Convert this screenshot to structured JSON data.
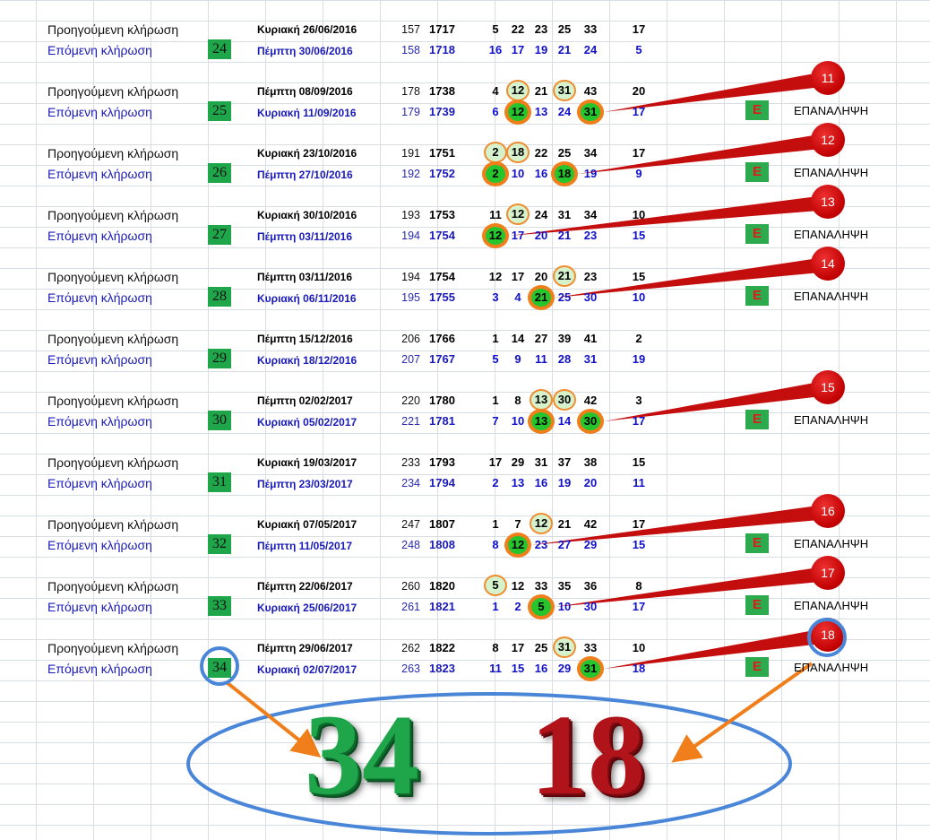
{
  "labels": {
    "prev": "Προηγούμενη κλήρωση",
    "next": "Επόμενη κλήρωση",
    "e_badge": "E",
    "repeat": "ΕΠΑΝΑΛΗΨΗ"
  },
  "blocks": [
    {
      "prev": {
        "date": "Κυριακή 26/06/2016",
        "idx": "157",
        "draw": "1717",
        "nums": [
          "5",
          "22",
          "23",
          "25",
          "33"
        ],
        "joker": "17"
      },
      "next": {
        "date": "Πέμπτη 30/06/2016",
        "idx": "158",
        "draw": "1718",
        "nums": [
          "16",
          "17",
          "19",
          "21",
          "24"
        ],
        "joker": "5"
      },
      "badge": "24",
      "repeat": false,
      "prev_hl": [],
      "next_hl": [],
      "pin": ""
    },
    {
      "prev": {
        "date": "Πέμπτη 08/09/2016",
        "idx": "178",
        "draw": "1738",
        "nums": [
          "4",
          "12",
          "21",
          "31",
          "43"
        ],
        "joker": "20"
      },
      "next": {
        "date": "Κυριακή 11/09/2016",
        "idx": "179",
        "draw": "1739",
        "nums": [
          "6",
          "12",
          "13",
          "24",
          "31"
        ],
        "joker": "17"
      },
      "badge": "25",
      "repeat": true,
      "prev_hl": [
        1,
        3
      ],
      "next_hl": [
        1,
        4
      ],
      "pin": "11"
    },
    {
      "prev": {
        "date": "Κυριακή 23/10/2016",
        "idx": "191",
        "draw": "1751",
        "nums": [
          "2",
          "18",
          "22",
          "25",
          "34"
        ],
        "joker": "17"
      },
      "next": {
        "date": "Πέμπτη 27/10/2016",
        "idx": "192",
        "draw": "1752",
        "nums": [
          "2",
          "10",
          "16",
          "18",
          "19"
        ],
        "joker": "9"
      },
      "badge": "26",
      "repeat": true,
      "prev_hl": [
        0,
        1
      ],
      "next_hl": [
        0,
        3
      ],
      "pin": "12"
    },
    {
      "prev": {
        "date": "Κυριακή 30/10/2016",
        "idx": "193",
        "draw": "1753",
        "nums": [
          "11",
          "12",
          "24",
          "31",
          "34"
        ],
        "joker": "10"
      },
      "next": {
        "date": "Πέμπτη 03/11/2016",
        "idx": "194",
        "draw": "1754",
        "nums": [
          "12",
          "17",
          "20",
          "21",
          "23"
        ],
        "joker": "15"
      },
      "badge": "27",
      "repeat": true,
      "prev_hl": [
        1
      ],
      "next_hl": [
        0
      ],
      "pin": "13"
    },
    {
      "prev": {
        "date": "Πέμπτη 03/11/2016",
        "idx": "194",
        "draw": "1754",
        "nums": [
          "12",
          "17",
          "20",
          "21",
          "23"
        ],
        "joker": "15"
      },
      "next": {
        "date": "Κυριακή 06/11/2016",
        "idx": "195",
        "draw": "1755",
        "nums": [
          "3",
          "4",
          "21",
          "25",
          "30"
        ],
        "joker": "10"
      },
      "badge": "28",
      "repeat": true,
      "prev_hl": [
        3
      ],
      "next_hl": [
        2
      ],
      "pin": "14"
    },
    {
      "prev": {
        "date": "Πέμπτη 15/12/2016",
        "idx": "206",
        "draw": "1766",
        "nums": [
          "1",
          "14",
          "27",
          "39",
          "41"
        ],
        "joker": "2"
      },
      "next": {
        "date": "Κυριακή 18/12/2016",
        "idx": "207",
        "draw": "1767",
        "nums": [
          "5",
          "9",
          "11",
          "28",
          "31"
        ],
        "joker": "19"
      },
      "badge": "29",
      "repeat": false,
      "prev_hl": [],
      "next_hl": [],
      "pin": ""
    },
    {
      "prev": {
        "date": "Πέμπτη 02/02/2017",
        "idx": "220",
        "draw": "1780",
        "nums": [
          "1",
          "8",
          "13",
          "30",
          "42"
        ],
        "joker": "3"
      },
      "next": {
        "date": "Κυριακή 05/02/2017",
        "idx": "221",
        "draw": "1781",
        "nums": [
          "7",
          "10",
          "13",
          "14",
          "30"
        ],
        "joker": "17"
      },
      "badge": "30",
      "repeat": true,
      "prev_hl": [
        2,
        3
      ],
      "next_hl": [
        2,
        4
      ],
      "pin": "15"
    },
    {
      "prev": {
        "date": "Κυριακή 19/03/2017",
        "idx": "233",
        "draw": "1793",
        "nums": [
          "17",
          "29",
          "31",
          "37",
          "38"
        ],
        "joker": "15"
      },
      "next": {
        "date": "Πέμπτη 23/03/2017",
        "idx": "234",
        "draw": "1794",
        "nums": [
          "2",
          "13",
          "16",
          "19",
          "20"
        ],
        "joker": "11"
      },
      "badge": "31",
      "repeat": false,
      "prev_hl": [],
      "next_hl": [],
      "pin": ""
    },
    {
      "prev": {
        "date": "Κυριακή 07/05/2017",
        "idx": "247",
        "draw": "1807",
        "nums": [
          "1",
          "7",
          "12",
          "21",
          "42"
        ],
        "joker": "17"
      },
      "next": {
        "date": "Πέμπτη 11/05/2017",
        "idx": "248",
        "draw": "1808",
        "nums": [
          "8",
          "12",
          "23",
          "27",
          "29"
        ],
        "joker": "15"
      },
      "badge": "32",
      "repeat": true,
      "prev_hl": [
        2
      ],
      "next_hl": [
        1
      ],
      "pin": "16"
    },
    {
      "prev": {
        "date": "Πέμπτη 22/06/2017",
        "idx": "260",
        "draw": "1820",
        "nums": [
          "5",
          "12",
          "33",
          "35",
          "36"
        ],
        "joker": "8"
      },
      "next": {
        "date": "Κυριακή 25/06/2017",
        "idx": "261",
        "draw": "1821",
        "nums": [
          "1",
          "2",
          "5",
          "10",
          "30"
        ],
        "joker": "17"
      },
      "badge": "33",
      "repeat": true,
      "prev_hl": [
        0
      ],
      "next_hl": [
        2
      ],
      "pin": "17"
    },
    {
      "prev": {
        "date": "Πέμπτη 29/06/2017",
        "idx": "262",
        "draw": "1822",
        "nums": [
          "8",
          "17",
          "25",
          "31",
          "33"
        ],
        "joker": "10"
      },
      "next": {
        "date": "Κυριακή 02/07/2017",
        "idx": "263",
        "draw": "1823",
        "nums": [
          "11",
          "15",
          "16",
          "29",
          "31"
        ],
        "joker": "18"
      },
      "badge": "34",
      "repeat": true,
      "prev_hl": [
        3
      ],
      "next_hl": [
        4
      ],
      "pin": "18"
    }
  ],
  "result": {
    "green": "34",
    "red": "18"
  },
  "colors": {
    "badge_green": "#1fa64a",
    "pin_red": "#c00000",
    "highlight_orange": "#f07e1a",
    "ring_blue": "#4a86d8"
  }
}
